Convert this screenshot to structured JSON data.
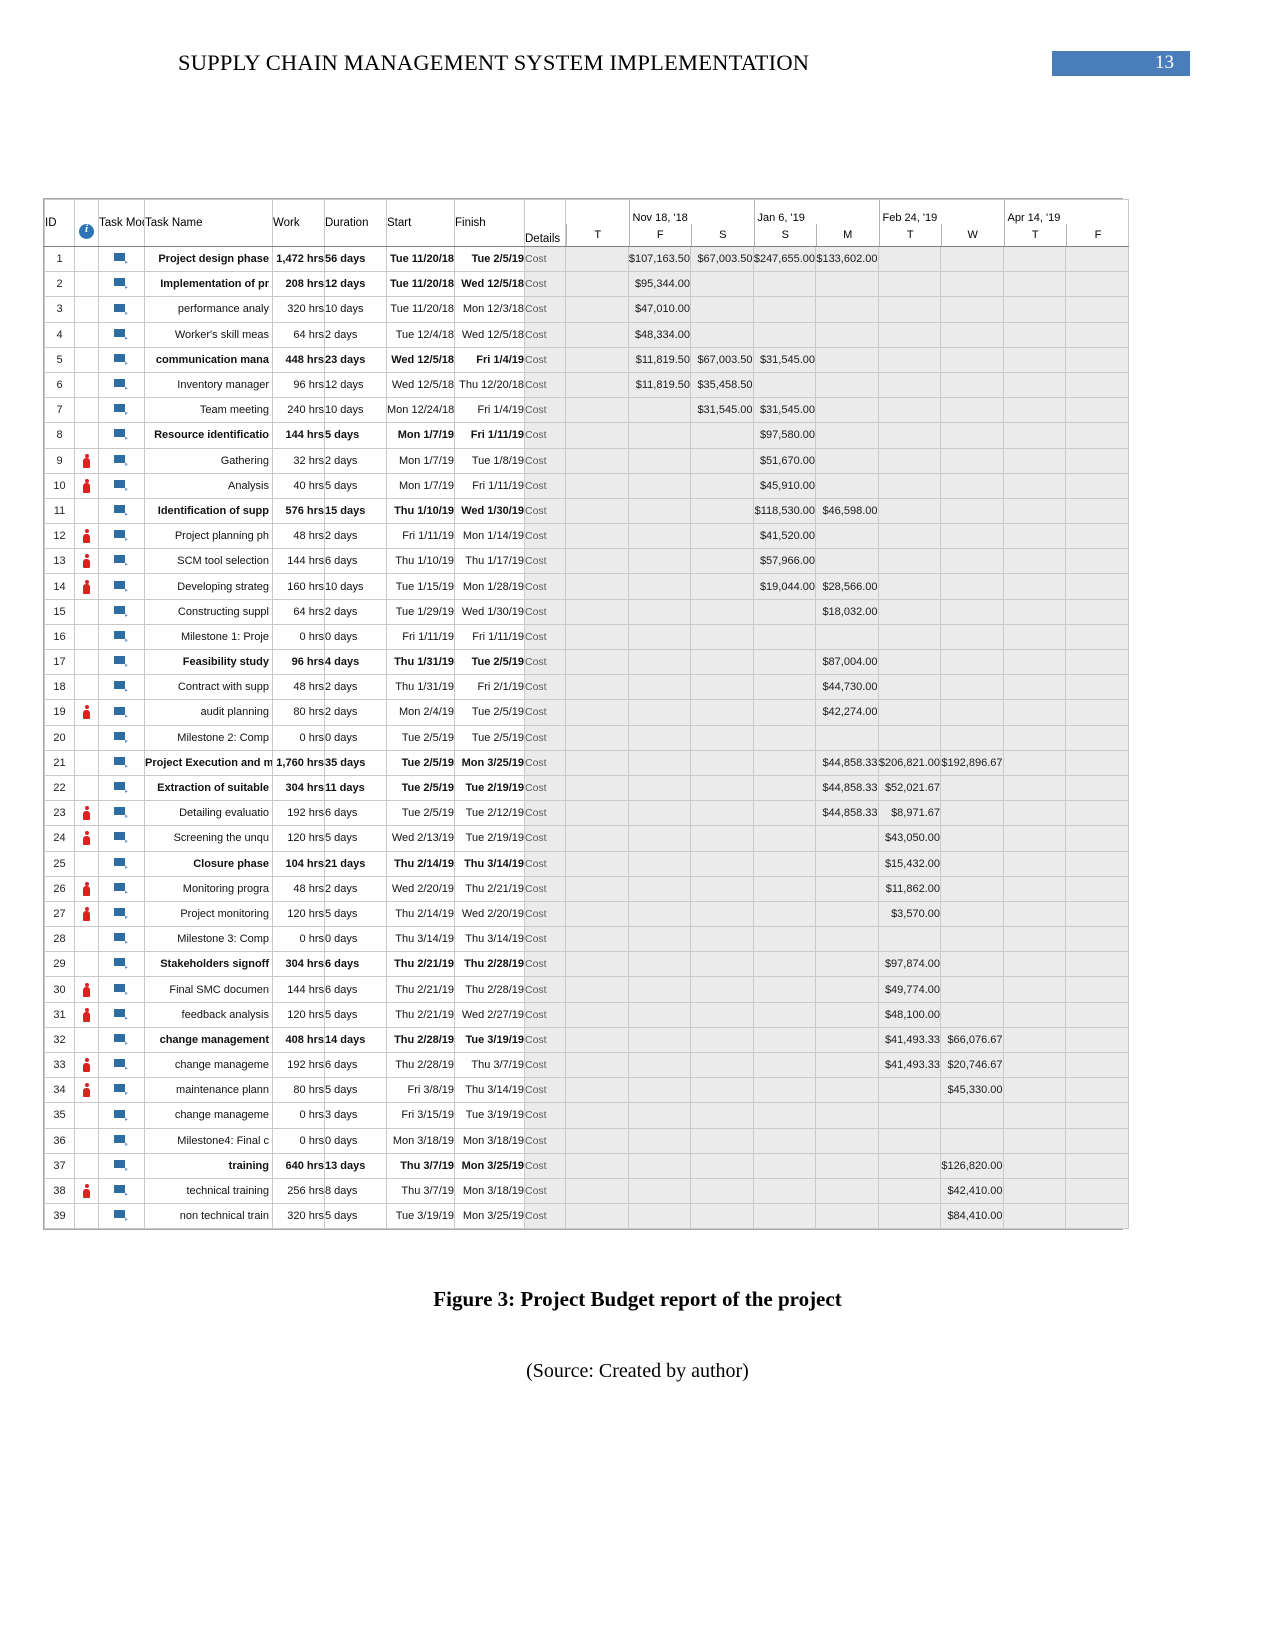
{
  "header": {
    "document_title": "SUPPLY CHAIN MANAGEMENT SYSTEM IMPLEMENTATION",
    "page_number": "13",
    "accent_color": "#4a7ebb"
  },
  "figure": {
    "caption": "Figure 3: Project Budget report of the project",
    "source": "(Source: Created by author)"
  },
  "table": {
    "columns": {
      "id": "ID",
      "indicator": "info-icon",
      "task_mode": "Task Mode",
      "task_name": "Task Name",
      "work": "Work",
      "duration": "Duration",
      "start": "Start",
      "finish": "Finish",
      "details": "Details"
    },
    "timescale": {
      "top_tier": [
        {
          "label": "",
          "span": 1
        },
        {
          "label": "Nov 18, '18",
          "span": 2
        },
        {
          "label": "Jan 6, '19",
          "span": 2
        },
        {
          "label": "Feb 24, '19",
          "span": 2
        },
        {
          "label": "Apr 14, '19",
          "span": 1
        }
      ],
      "bottom_tier": [
        "T",
        "F",
        "S",
        "S",
        "M",
        "T",
        "W",
        "T",
        "F"
      ]
    },
    "detail_label": "Cost",
    "rows": [
      {
        "id": "1",
        "indicator": false,
        "level": 0,
        "bold": true,
        "name": "Project design phase",
        "work": "1,472 hrs",
        "duration": "56 days",
        "start": "Tue 11/20/18",
        "finish": "Tue 2/5/19",
        "costs": [
          "",
          "$107,163.50",
          "$67,003.50",
          "$247,655.00",
          "$133,602.00",
          "",
          "",
          "",
          ""
        ]
      },
      {
        "id": "2",
        "indicator": false,
        "level": 1,
        "bold": true,
        "name": "Implementation of pr",
        "work": "208 hrs",
        "duration": "12 days",
        "start": "Tue 11/20/18",
        "finish": "Wed 12/5/18",
        "costs": [
          "",
          "$95,344.00",
          "",
          "",
          "",
          "",
          "",
          "",
          ""
        ]
      },
      {
        "id": "3",
        "indicator": false,
        "level": 2,
        "bold": false,
        "name": "performance analy",
        "work": "320 hrs",
        "duration": "10 days",
        "start": "Tue 11/20/18",
        "finish": "Mon 12/3/18",
        "costs": [
          "",
          "$47,010.00",
          "",
          "",
          "",
          "",
          "",
          "",
          ""
        ]
      },
      {
        "id": "4",
        "indicator": false,
        "level": 2,
        "bold": false,
        "name": "Worker's skill meas",
        "work": "64 hrs",
        "duration": "2 days",
        "start": "Tue 12/4/18",
        "finish": "Wed 12/5/18",
        "costs": [
          "",
          "$48,334.00",
          "",
          "",
          "",
          "",
          "",
          "",
          ""
        ]
      },
      {
        "id": "5",
        "indicator": false,
        "level": 1,
        "bold": true,
        "name": "communication mana",
        "work": "448 hrs",
        "duration": "23 days",
        "start": "Wed 12/5/18",
        "finish": "Fri 1/4/19",
        "costs": [
          "",
          "$11,819.50",
          "$67,003.50",
          "$31,545.00",
          "",
          "",
          "",
          "",
          ""
        ]
      },
      {
        "id": "6",
        "indicator": false,
        "level": 2,
        "bold": false,
        "name": "Inventory manager",
        "work": "96 hrs",
        "duration": "12 days",
        "start": "Wed 12/5/18",
        "finish": "Thu 12/20/18",
        "costs": [
          "",
          "$11,819.50",
          "$35,458.50",
          "",
          "",
          "",
          "",
          "",
          ""
        ]
      },
      {
        "id": "7",
        "indicator": false,
        "level": 2,
        "bold": false,
        "name": "Team meeting",
        "work": "240 hrs",
        "duration": "10 days",
        "start": "Mon 12/24/18",
        "finish": "Fri 1/4/19",
        "costs": [
          "",
          "",
          "$31,545.00",
          "$31,545.00",
          "",
          "",
          "",
          "",
          ""
        ]
      },
      {
        "id": "8",
        "indicator": false,
        "level": 1,
        "bold": true,
        "name": "Resource identificatio",
        "work": "144 hrs",
        "duration": "5 days",
        "start": "Mon 1/7/19",
        "finish": "Fri 1/11/19",
        "costs": [
          "",
          "",
          "",
          "$97,580.00",
          "",
          "",
          "",
          "",
          ""
        ]
      },
      {
        "id": "9",
        "indicator": true,
        "level": 2,
        "bold": false,
        "name": "Gathering",
        "work": "32 hrs",
        "duration": "2 days",
        "start": "Mon 1/7/19",
        "finish": "Tue 1/8/19",
        "costs": [
          "",
          "",
          "",
          "$51,670.00",
          "",
          "",
          "",
          "",
          ""
        ]
      },
      {
        "id": "10",
        "indicator": true,
        "level": 2,
        "bold": false,
        "name": "Analysis",
        "work": "40 hrs",
        "duration": "5 days",
        "start": "Mon 1/7/19",
        "finish": "Fri 1/11/19",
        "costs": [
          "",
          "",
          "",
          "$45,910.00",
          "",
          "",
          "",
          "",
          ""
        ]
      },
      {
        "id": "11",
        "indicator": false,
        "level": 1,
        "bold": true,
        "name": "Identification of supp",
        "work": "576 hrs",
        "duration": "15 days",
        "start": "Thu 1/10/19",
        "finish": "Wed 1/30/19",
        "costs": [
          "",
          "",
          "",
          "$118,530.00",
          "$46,598.00",
          "",
          "",
          "",
          ""
        ]
      },
      {
        "id": "12",
        "indicator": true,
        "level": 2,
        "bold": false,
        "name": "Project planning ph",
        "work": "48 hrs",
        "duration": "2 days",
        "start": "Fri 1/11/19",
        "finish": "Mon 1/14/19",
        "costs": [
          "",
          "",
          "",
          "$41,520.00",
          "",
          "",
          "",
          "",
          ""
        ]
      },
      {
        "id": "13",
        "indicator": true,
        "level": 2,
        "bold": false,
        "name": "SCM tool selection",
        "work": "144 hrs",
        "duration": "6 days",
        "start": "Thu 1/10/19",
        "finish": "Thu 1/17/19",
        "costs": [
          "",
          "",
          "",
          "$57,966.00",
          "",
          "",
          "",
          "",
          ""
        ]
      },
      {
        "id": "14",
        "indicator": true,
        "level": 2,
        "bold": false,
        "name": "Developing strateg",
        "work": "160 hrs",
        "duration": "10 days",
        "start": "Tue 1/15/19",
        "finish": "Mon 1/28/19",
        "costs": [
          "",
          "",
          "",
          "$19,044.00",
          "$28,566.00",
          "",
          "",
          "",
          ""
        ]
      },
      {
        "id": "15",
        "indicator": false,
        "level": 2,
        "bold": false,
        "name": "Constructing suppl",
        "work": "64 hrs",
        "duration": "2 days",
        "start": "Tue 1/29/19",
        "finish": "Wed 1/30/19",
        "costs": [
          "",
          "",
          "",
          "",
          "$18,032.00",
          "",
          "",
          "",
          ""
        ]
      },
      {
        "id": "16",
        "indicator": false,
        "level": 2,
        "bold": false,
        "name": "Milestone 1: Proje",
        "work": "0 hrs",
        "duration": "0 days",
        "start": "Fri 1/11/19",
        "finish": "Fri 1/11/19",
        "costs": [
          "",
          "",
          "",
          "",
          "",
          "",
          "",
          "",
          ""
        ]
      },
      {
        "id": "17",
        "indicator": false,
        "level": 1,
        "bold": true,
        "name": "Feasibility study",
        "work": "96 hrs",
        "duration": "4 days",
        "start": "Thu 1/31/19",
        "finish": "Tue 2/5/19",
        "costs": [
          "",
          "",
          "",
          "",
          "$87,004.00",
          "",
          "",
          "",
          ""
        ]
      },
      {
        "id": "18",
        "indicator": false,
        "level": 2,
        "bold": false,
        "name": "Contract with supp",
        "work": "48 hrs",
        "duration": "2 days",
        "start": "Thu 1/31/19",
        "finish": "Fri 2/1/19",
        "costs": [
          "",
          "",
          "",
          "",
          "$44,730.00",
          "",
          "",
          "",
          ""
        ]
      },
      {
        "id": "19",
        "indicator": true,
        "level": 2,
        "bold": false,
        "name": "audit planning",
        "work": "80 hrs",
        "duration": "2 days",
        "start": "Mon 2/4/19",
        "finish": "Tue 2/5/19",
        "costs": [
          "",
          "",
          "",
          "",
          "$42,274.00",
          "",
          "",
          "",
          ""
        ]
      },
      {
        "id": "20",
        "indicator": false,
        "level": 2,
        "bold": false,
        "name": "Milestone 2: Comp",
        "work": "0 hrs",
        "duration": "0 days",
        "start": "Tue 2/5/19",
        "finish": "Tue 2/5/19",
        "costs": [
          "",
          "",
          "",
          "",
          "",
          "",
          "",
          "",
          ""
        ]
      },
      {
        "id": "21",
        "indicator": false,
        "level": 0,
        "bold": true,
        "name": "Project Execution and m",
        "work": "1,760 hrs",
        "duration": "35 days",
        "start": "Tue 2/5/19",
        "finish": "Mon 3/25/19",
        "costs": [
          "",
          "",
          "",
          "",
          "$44,858.33",
          "$206,821.00",
          "$192,896.67",
          "",
          ""
        ]
      },
      {
        "id": "22",
        "indicator": false,
        "level": 1,
        "bold": true,
        "name": "Extraction of suitable",
        "work": "304 hrs",
        "duration": "11 days",
        "start": "Tue 2/5/19",
        "finish": "Tue 2/19/19",
        "costs": [
          "",
          "",
          "",
          "",
          "$44,858.33",
          "$52,021.67",
          "",
          "",
          ""
        ]
      },
      {
        "id": "23",
        "indicator": true,
        "level": 2,
        "bold": false,
        "name": "Detailing evaluatio",
        "work": "192 hrs",
        "duration": "6 days",
        "start": "Tue 2/5/19",
        "finish": "Tue 2/12/19",
        "costs": [
          "",
          "",
          "",
          "",
          "$44,858.33",
          "$8,971.67",
          "",
          "",
          ""
        ]
      },
      {
        "id": "24",
        "indicator": true,
        "level": 2,
        "bold": false,
        "name": "Screening the unqu",
        "work": "120 hrs",
        "duration": "5 days",
        "start": "Wed 2/13/19",
        "finish": "Tue 2/19/19",
        "costs": [
          "",
          "",
          "",
          "",
          "",
          "$43,050.00",
          "",
          "",
          ""
        ]
      },
      {
        "id": "25",
        "indicator": false,
        "level": 1,
        "bold": true,
        "name": "Closure phase",
        "work": "104 hrs",
        "duration": "21 days",
        "start": "Thu 2/14/19",
        "finish": "Thu 3/14/19",
        "costs": [
          "",
          "",
          "",
          "",
          "",
          "$15,432.00",
          "",
          "",
          ""
        ]
      },
      {
        "id": "26",
        "indicator": true,
        "level": 2,
        "bold": false,
        "name": "Monitoring progra",
        "work": "48 hrs",
        "duration": "2 days",
        "start": "Wed 2/20/19",
        "finish": "Thu 2/21/19",
        "costs": [
          "",
          "",
          "",
          "",
          "",
          "$11,862.00",
          "",
          "",
          ""
        ]
      },
      {
        "id": "27",
        "indicator": true,
        "level": 2,
        "bold": false,
        "name": "Project monitoring",
        "work": "120 hrs",
        "duration": "5 days",
        "start": "Thu 2/14/19",
        "finish": "Wed 2/20/19",
        "costs": [
          "",
          "",
          "",
          "",
          "",
          "$3,570.00",
          "",
          "",
          ""
        ]
      },
      {
        "id": "28",
        "indicator": false,
        "level": 2,
        "bold": false,
        "name": "Milestone 3: Comp",
        "work": "0 hrs",
        "duration": "0 days",
        "start": "Thu 3/14/19",
        "finish": "Thu 3/14/19",
        "costs": [
          "",
          "",
          "",
          "",
          "",
          "",
          "",
          "",
          ""
        ]
      },
      {
        "id": "29",
        "indicator": false,
        "level": 1,
        "bold": true,
        "name": "Stakeholders signoff",
        "work": "304 hrs",
        "duration": "6 days",
        "start": "Thu 2/21/19",
        "finish": "Thu 2/28/19",
        "costs": [
          "",
          "",
          "",
          "",
          "",
          "$97,874.00",
          "",
          "",
          ""
        ]
      },
      {
        "id": "30",
        "indicator": true,
        "level": 2,
        "bold": false,
        "name": "Final SMC documen",
        "work": "144 hrs",
        "duration": "6 days",
        "start": "Thu 2/21/19",
        "finish": "Thu 2/28/19",
        "costs": [
          "",
          "",
          "",
          "",
          "",
          "$49,774.00",
          "",
          "",
          ""
        ]
      },
      {
        "id": "31",
        "indicator": true,
        "level": 2,
        "bold": false,
        "name": "feedback analysis",
        "work": "120 hrs",
        "duration": "5 days",
        "start": "Thu 2/21/19",
        "finish": "Wed 2/27/19",
        "costs": [
          "",
          "",
          "",
          "",
          "",
          "$48,100.00",
          "",
          "",
          ""
        ]
      },
      {
        "id": "32",
        "indicator": false,
        "level": 1,
        "bold": true,
        "name": "change management",
        "work": "408 hrs",
        "duration": "14 days",
        "start": "Thu 2/28/19",
        "finish": "Tue 3/19/19",
        "costs": [
          "",
          "",
          "",
          "",
          "",
          "$41,493.33",
          "$66,076.67",
          "",
          ""
        ]
      },
      {
        "id": "33",
        "indicator": true,
        "level": 2,
        "bold": false,
        "name": "change manageme",
        "work": "192 hrs",
        "duration": "6 days",
        "start": "Thu 2/28/19",
        "finish": "Thu 3/7/19",
        "costs": [
          "",
          "",
          "",
          "",
          "",
          "$41,493.33",
          "$20,746.67",
          "",
          ""
        ]
      },
      {
        "id": "34",
        "indicator": true,
        "level": 2,
        "bold": false,
        "name": "maintenance plann",
        "work": "80 hrs",
        "duration": "5 days",
        "start": "Fri 3/8/19",
        "finish": "Thu 3/14/19",
        "costs": [
          "",
          "",
          "",
          "",
          "",
          "",
          "$45,330.00",
          "",
          ""
        ]
      },
      {
        "id": "35",
        "indicator": false,
        "level": 2,
        "bold": false,
        "name": "change  manageme",
        "work": "0 hrs",
        "duration": "3 days",
        "start": "Fri 3/15/19",
        "finish": "Tue 3/19/19",
        "costs": [
          "",
          "",
          "",
          "",
          "",
          "",
          "",
          "",
          ""
        ]
      },
      {
        "id": "36",
        "indicator": false,
        "level": 2,
        "bold": false,
        "name": "Milestone4: Final c",
        "work": "0 hrs",
        "duration": "0 days",
        "start": "Mon 3/18/19",
        "finish": "Mon 3/18/19",
        "costs": [
          "",
          "",
          "",
          "",
          "",
          "",
          "",
          "",
          ""
        ]
      },
      {
        "id": "37",
        "indicator": false,
        "level": 1,
        "bold": true,
        "name": "training",
        "work": "640 hrs",
        "duration": "13 days",
        "start": "Thu 3/7/19",
        "finish": "Mon 3/25/19",
        "costs": [
          "",
          "",
          "",
          "",
          "",
          "",
          "$126,820.00",
          "",
          ""
        ]
      },
      {
        "id": "38",
        "indicator": true,
        "level": 2,
        "bold": false,
        "name": "technical training",
        "work": "256 hrs",
        "duration": "8 days",
        "start": "Thu 3/7/19",
        "finish": "Mon 3/18/19",
        "costs": [
          "",
          "",
          "",
          "",
          "",
          "",
          "$42,410.00",
          "",
          ""
        ]
      },
      {
        "id": "39",
        "indicator": false,
        "level": 2,
        "bold": false,
        "name": "non technical train",
        "work": "320 hrs",
        "duration": "5 days",
        "start": "Tue 3/19/19",
        "finish": "Mon 3/25/19",
        "costs": [
          "",
          "",
          "",
          "",
          "",
          "",
          "$84,410.00",
          "",
          ""
        ]
      }
    ]
  }
}
